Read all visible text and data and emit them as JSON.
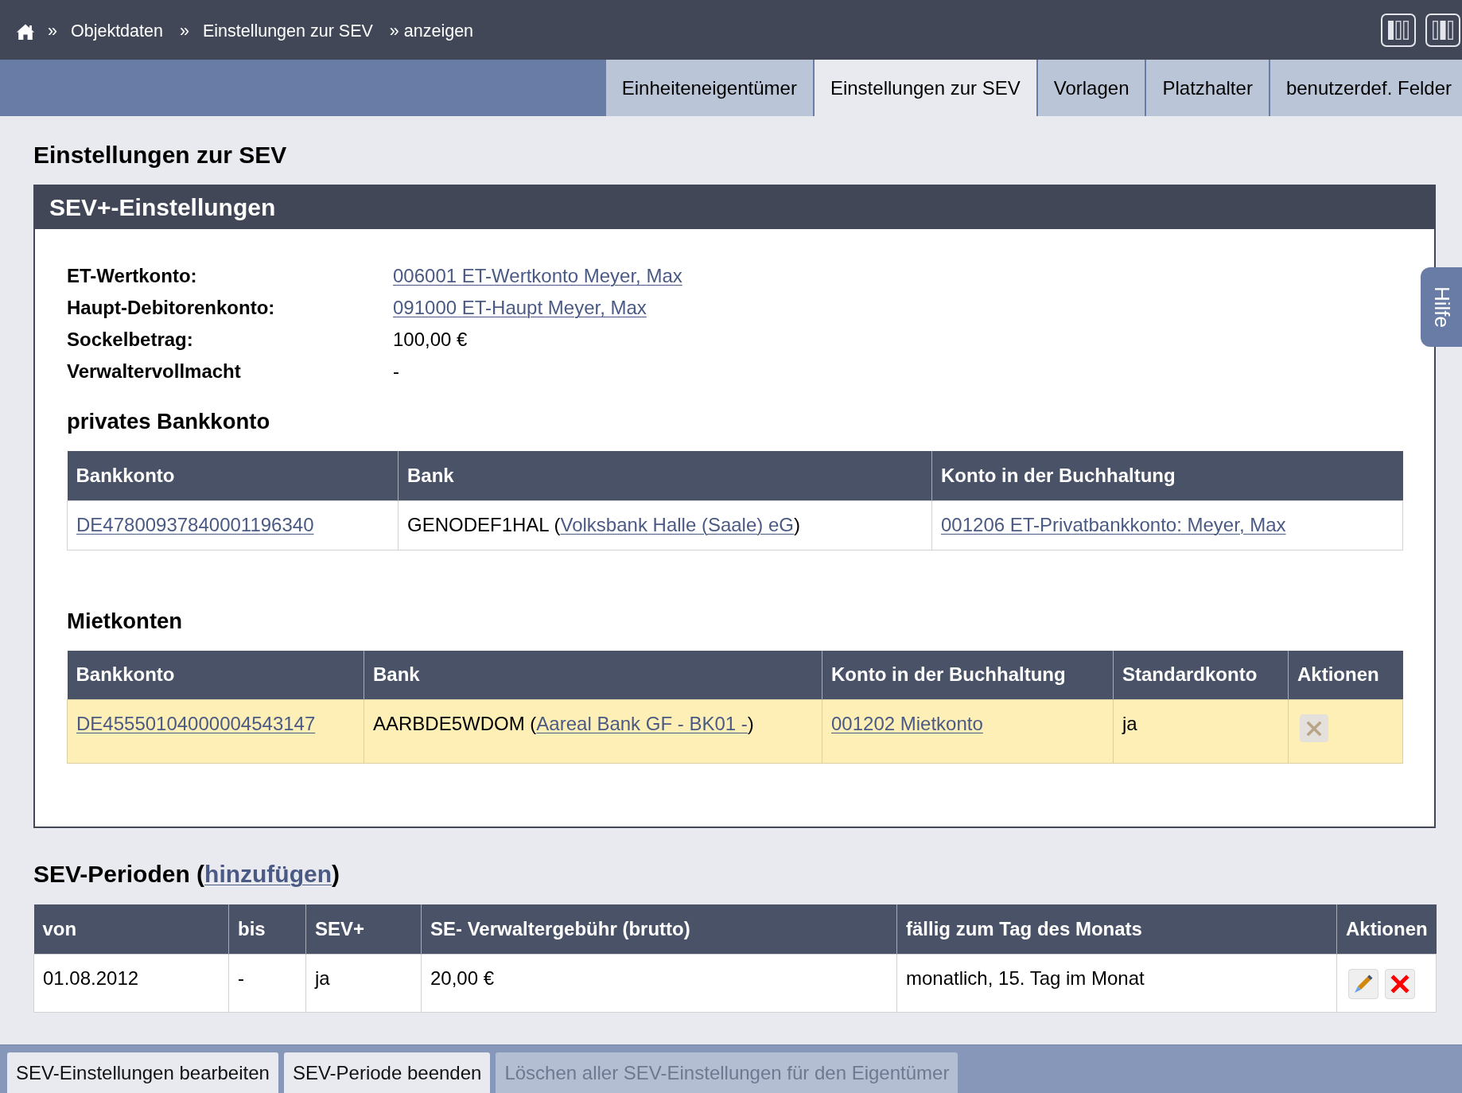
{
  "breadcrumb": [
    {
      "separator": "»",
      "label": "Objektdaten"
    },
    {
      "separator": "»",
      "label": "Einstellungen zur SEV"
    },
    {
      "separator": "»",
      "label": "anzeigen"
    }
  ],
  "tabs": [
    {
      "label": "Einheiteneigentümer",
      "selected": false
    },
    {
      "label": "Einstellungen zur SEV",
      "selected": true
    },
    {
      "label": "Vorlagen",
      "selected": false
    },
    {
      "label": "Platzhalter",
      "selected": false
    },
    {
      "label": "benutzerdef. Felder",
      "selected": false
    }
  ],
  "page_title": "Einstellungen zur SEV",
  "settings_panel": {
    "title": "SEV+-Einstellungen",
    "fields": [
      {
        "label": "ET-Wertkonto:",
        "value": "006001 ET-Wertkonto Meyer, Max",
        "kind": "link"
      },
      {
        "label": "Haupt-Debitorenkonto:",
        "value": "091000 ET-Haupt Meyer, Max",
        "kind": "link"
      },
      {
        "label": "Sockelbetrag:",
        "value": "100,00 €",
        "kind": "text"
      },
      {
        "label": "Verwaltervollmacht",
        "value": "-",
        "kind": "text"
      }
    ],
    "private_bank_account": {
      "heading": "privates Bankkonto",
      "table": {
        "columns": [
          "Bankkonto",
          "Bank",
          "Konto in der Buchhaltung"
        ],
        "rows": [
          {
            "highlighted": false,
            "cells": [
              {
                "kind": "text",
                "parts": [
                  {
                    "kind": "link",
                    "text": "DE47800937840001196340"
                  }
                ]
              },
              {
                "kind": "text",
                "parts": [
                  {
                    "kind": "text",
                    "text": "GENODEF1HAL ("
                  },
                  {
                    "kind": "link",
                    "text": "Volksbank Halle (Saale) eG"
                  },
                  {
                    "kind": "text",
                    "text": ")"
                  }
                ]
              },
              {
                "kind": "text",
                "parts": [
                  {
                    "kind": "link",
                    "text": "001206 ET-Privatbankkonto: Meyer, Max"
                  }
                ]
              }
            ]
          }
        ]
      }
    },
    "rent_accounts": {
      "heading": "Mietkonten",
      "table": {
        "columns": [
          "Bankkonto",
          "Bank",
          "Konto in der Buchhaltung",
          "Standardkonto",
          "Aktionen"
        ],
        "rows": [
          {
            "highlighted": true,
            "cells": [
              {
                "kind": "text",
                "parts": [
                  {
                    "kind": "link",
                    "text": "DE45550104000004543147"
                  }
                ]
              },
              {
                "kind": "text",
                "parts": [
                  {
                    "kind": "text",
                    "text": "AARBDE5WDOM ("
                  },
                  {
                    "kind": "link",
                    "text": "Aareal Bank GF - BK01 -"
                  },
                  {
                    "kind": "text",
                    "text": ")"
                  }
                ]
              },
              {
                "kind": "text",
                "parts": [
                  {
                    "kind": "link",
                    "text": "001202 Mietkonto"
                  }
                ]
              },
              {
                "kind": "text",
                "parts": [
                  {
                    "kind": "text",
                    "text": "ja"
                  }
                ]
              },
              {
                "kind": "actions",
                "actions": [
                  {
                    "kind": "delete",
                    "disabled": true
                  }
                ]
              }
            ]
          }
        ]
      }
    }
  },
  "periods": {
    "heading": [
      {
        "kind": "text",
        "text": "SEV-Perioden ("
      },
      {
        "kind": "link",
        "text": "hinzufügen"
      },
      {
        "kind": "text",
        "text": ")"
      }
    ],
    "table": {
      "columns": [
        "von",
        "bis",
        "SEV+",
        "SE- Verwaltergebühr (brutto)",
        "fällig zum Tag des Monats",
        "Aktionen"
      ],
      "rows": [
        {
          "highlighted": false,
          "cells": [
            {
              "kind": "text",
              "parts": [
                {
                  "kind": "text",
                  "text": "01.08.2012"
                }
              ]
            },
            {
              "kind": "text",
              "parts": [
                {
                  "kind": "text",
                  "text": "-"
                }
              ]
            },
            {
              "kind": "text",
              "parts": [
                {
                  "kind": "text",
                  "text": "ja"
                }
              ]
            },
            {
              "kind": "text",
              "parts": [
                {
                  "kind": "text",
                  "text": "20,00 €"
                }
              ]
            },
            {
              "kind": "text",
              "parts": [
                {
                  "kind": "text",
                  "text": "monatlich, 15. Tag im Monat"
                }
              ]
            },
            {
              "kind": "actions",
              "actions": [
                {
                  "kind": "edit",
                  "disabled": false
                },
                {
                  "kind": "delete",
                  "disabled": false
                }
              ]
            }
          ]
        }
      ]
    }
  },
  "footer_buttons": [
    {
      "label": "SEV-Einstellungen bearbeiten",
      "disabled": false
    },
    {
      "label": "SEV-Periode beenden",
      "disabled": false
    },
    {
      "label": "Löschen aller SEV-Einstellungen für den Eigentümer",
      "disabled": true
    }
  ],
  "help_tab": {
    "label": "Hilfe"
  }
}
